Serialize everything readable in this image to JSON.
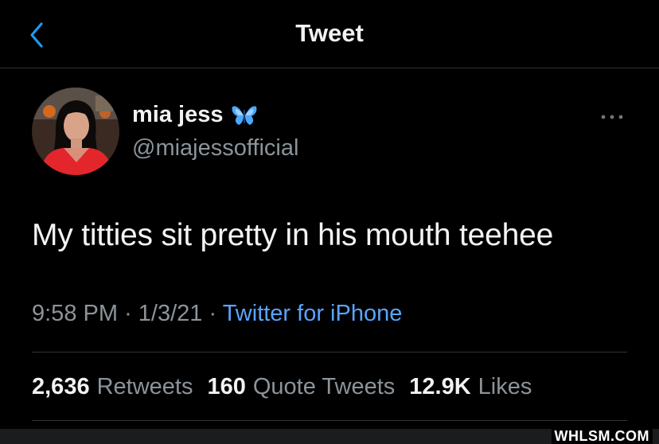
{
  "header": {
    "title": "Tweet"
  },
  "author": {
    "name": "mia jess",
    "handle": "@miajessofficial"
  },
  "tweet": {
    "text": "My titties sit pretty in his mouth teehee",
    "time": "9:58 PM",
    "date": "1/3/21",
    "source": "Twitter for iPhone"
  },
  "stats": {
    "retweets_count": "2,636",
    "retweets_label": "Retweets",
    "quotes_count": "160",
    "quotes_label": "Quote Tweets",
    "likes_count": "12.9K",
    "likes_label": "Likes"
  },
  "watermark": "WHLSM.COM",
  "colors": {
    "accent": "#1d9bf0",
    "background": "#000000",
    "secondary_text": "#8b949a"
  },
  "icons": {
    "back": "chevron-left-icon",
    "more": "more-dots-icon",
    "badge": "butterfly-icon"
  }
}
